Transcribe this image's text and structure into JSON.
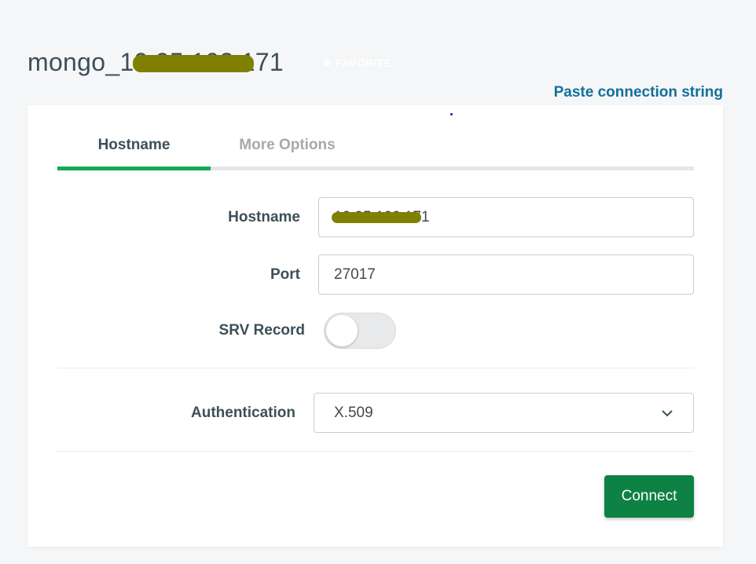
{
  "header": {
    "title": "mongo_10.95.102.171",
    "favorite_label": "FAVORITE",
    "paste_link": "Paste connection string"
  },
  "tabs": [
    {
      "label": "Hostname",
      "active": true
    },
    {
      "label": "More Options",
      "active": false
    }
  ],
  "form": {
    "hostname": {
      "label": "Hostname",
      "value": "10.95.102.171"
    },
    "port": {
      "label": "Port",
      "value": "27017"
    },
    "srv": {
      "label": "SRV Record",
      "enabled": false
    },
    "authentication": {
      "label": "Authentication",
      "selected": "X.509"
    }
  },
  "actions": {
    "connect_label": "Connect"
  },
  "colors": {
    "accent_green": "#13aa52",
    "button_green": "#0e8145",
    "link_blue": "#136f9c",
    "redaction": "#808000"
  },
  "icons": {
    "favorite": "star-icon",
    "select": "chevron-down-icon"
  }
}
